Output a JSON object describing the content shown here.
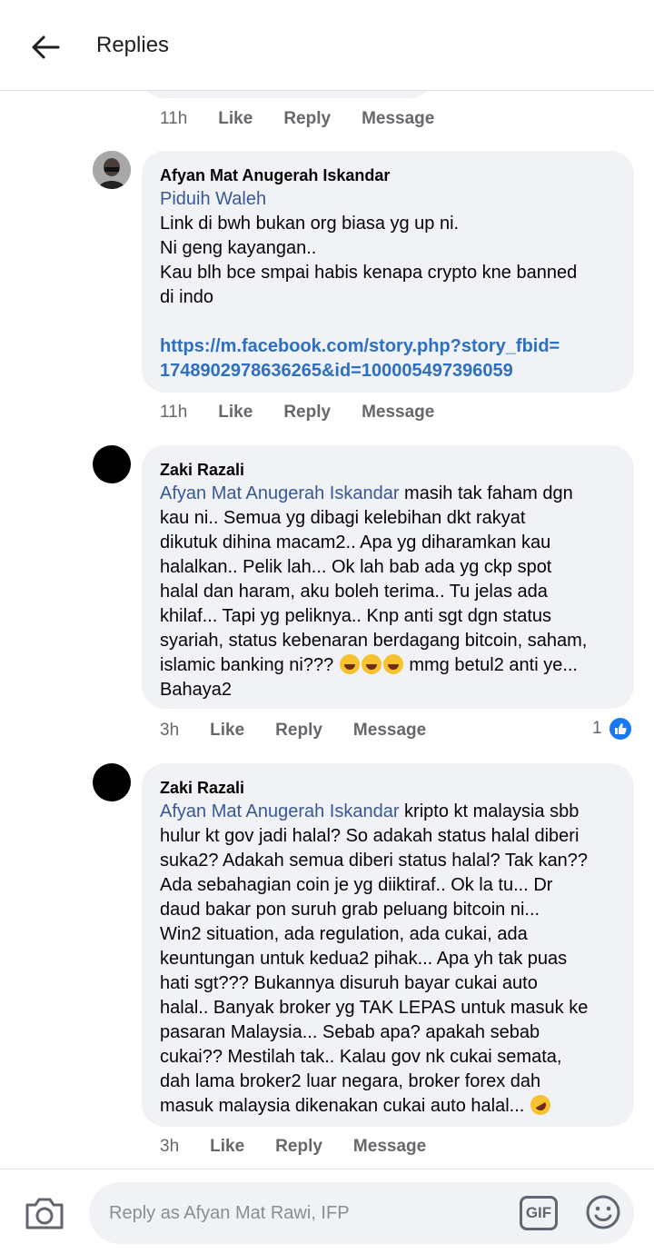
{
  "header": {
    "title": "Replies"
  },
  "previous": {
    "time": "11h",
    "like": "Like",
    "reply": "Reply",
    "message": "Message"
  },
  "comments": [
    {
      "author": "Afyan Mat Anugerah Iskandar",
      "mention": "Piduih Waleh",
      "lines": [
        "Link di bwh bukan org biasa yg up ni.",
        "Ni geng kayangan..",
        "Kau blh bce smpai habis kenapa crypto kne banned",
        "di indo"
      ],
      "link_line1": "https://m.facebook.com/story.php?story_fbid=",
      "link_line2": "1748902978636265&id=100005497396059",
      "time": "11h",
      "like": "Like",
      "reply": "Reply",
      "message": "Message"
    },
    {
      "author": "Zaki Razali",
      "mention": "Afyan Mat Anugerah Iskandar",
      "line1": " masih tak faham dgn",
      "lines": [
        "kau ni.. Semua yg dibagi kelebihan dkt rakyat",
        "dikutuk dihina macam2.. Apa yg diharamkan kau",
        "halalkan.. Pelik lah... Ok lah bab ada yg ckp spot",
        "halal dan haram, aku boleh terima.. Tu jelas ada",
        "khilaf... Tapi yg peliknya.. Knp anti sgt dgn status",
        "syariah, status kebenaran berdagang bitcoin, saham,"
      ],
      "line_emoji_before": "islamic banking ni??? ",
      "line_emoji_after": " mmg betul2 anti ye...",
      "last_line": "Bahaya2",
      "emoji_name": "laughing-emoji",
      "time": "3h",
      "like": "Like",
      "reply": "Reply",
      "message": "Message",
      "reaction_count": "1"
    },
    {
      "author": "Zaki Razali",
      "mention": "Afyan Mat Anugerah Iskandar",
      "line1": " kripto kt malaysia sbb",
      "lines": [
        "hulur kt gov jadi halal? So adakah status halal diberi",
        "suka2? Adakah semua diberi status halal? Tak kan??",
        "Ada sebahagian coin je yg diiktiraf.. Ok la tu... Dr",
        "daud bakar pon suruh grab peluang bitcoin ni...",
        "Win2 situation, ada regulation, ada cukai, ada",
        "keuntungan untuk kedua2 pihak... Apa yh tak puas",
        "hati sgt??? Bukannya disuruh bayar cukai auto",
        "halal.. Banyak broker yg TAK LEPAS untuk masuk ke",
        "pasaran Malaysia... Sebab apa? apakah sebab",
        "cukai?? Mestilah tak.. Kalau gov nk cukai semata,",
        "dah lama broker2 luar negara, broker forex dah"
      ],
      "last_line": "masuk malaysia dikenakan cukai auto halal... ",
      "emoji_name": "rolling-laughing-emoji",
      "time": "3h",
      "like": "Like",
      "reply": "Reply",
      "message": "Message"
    }
  ],
  "composer": {
    "placeholder": "Reply as Afyan Mat Rawi, IFP",
    "gif_label": "GIF"
  },
  "colors": {
    "accent": "#1877f2",
    "mention": "#385898",
    "link": "#2d6fc1",
    "bubble": "#f0f2f5"
  }
}
